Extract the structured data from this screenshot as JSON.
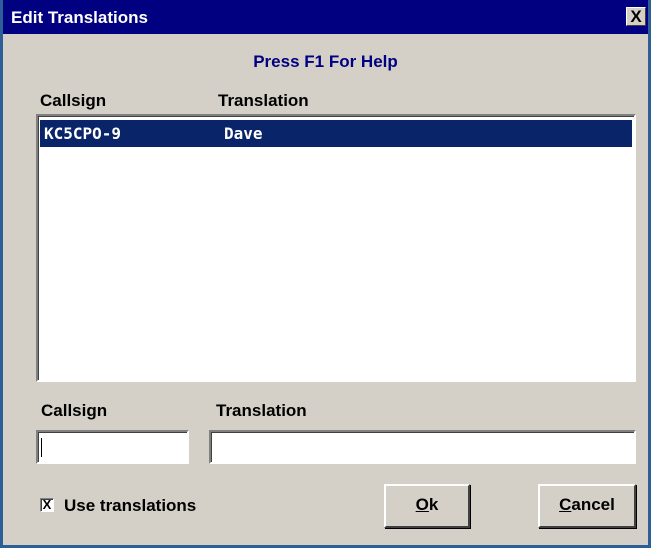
{
  "window": {
    "title": "Edit Translations",
    "close_glyph": "X"
  },
  "help_text": "Press F1 For Help",
  "list": {
    "headers": {
      "callsign": "Callsign",
      "translation": "Translation"
    },
    "rows": [
      {
        "callsign": "KC5CPO-9",
        "translation": "Dave",
        "selected": true
      }
    ]
  },
  "fields": {
    "callsign_label": "Callsign",
    "translation_label": "Translation",
    "callsign_value": "",
    "translation_value": ""
  },
  "use_translations": {
    "label": "Use translations",
    "checked": true,
    "mark": "X"
  },
  "buttons": {
    "ok": "Ok",
    "cancel": "Cancel"
  },
  "colors": {
    "title_bar": "#000080",
    "help_text": "#000080",
    "selection": "#0a246a",
    "dialog_face": "#d4d0c8"
  },
  "icons": {
    "close": "close-icon"
  }
}
